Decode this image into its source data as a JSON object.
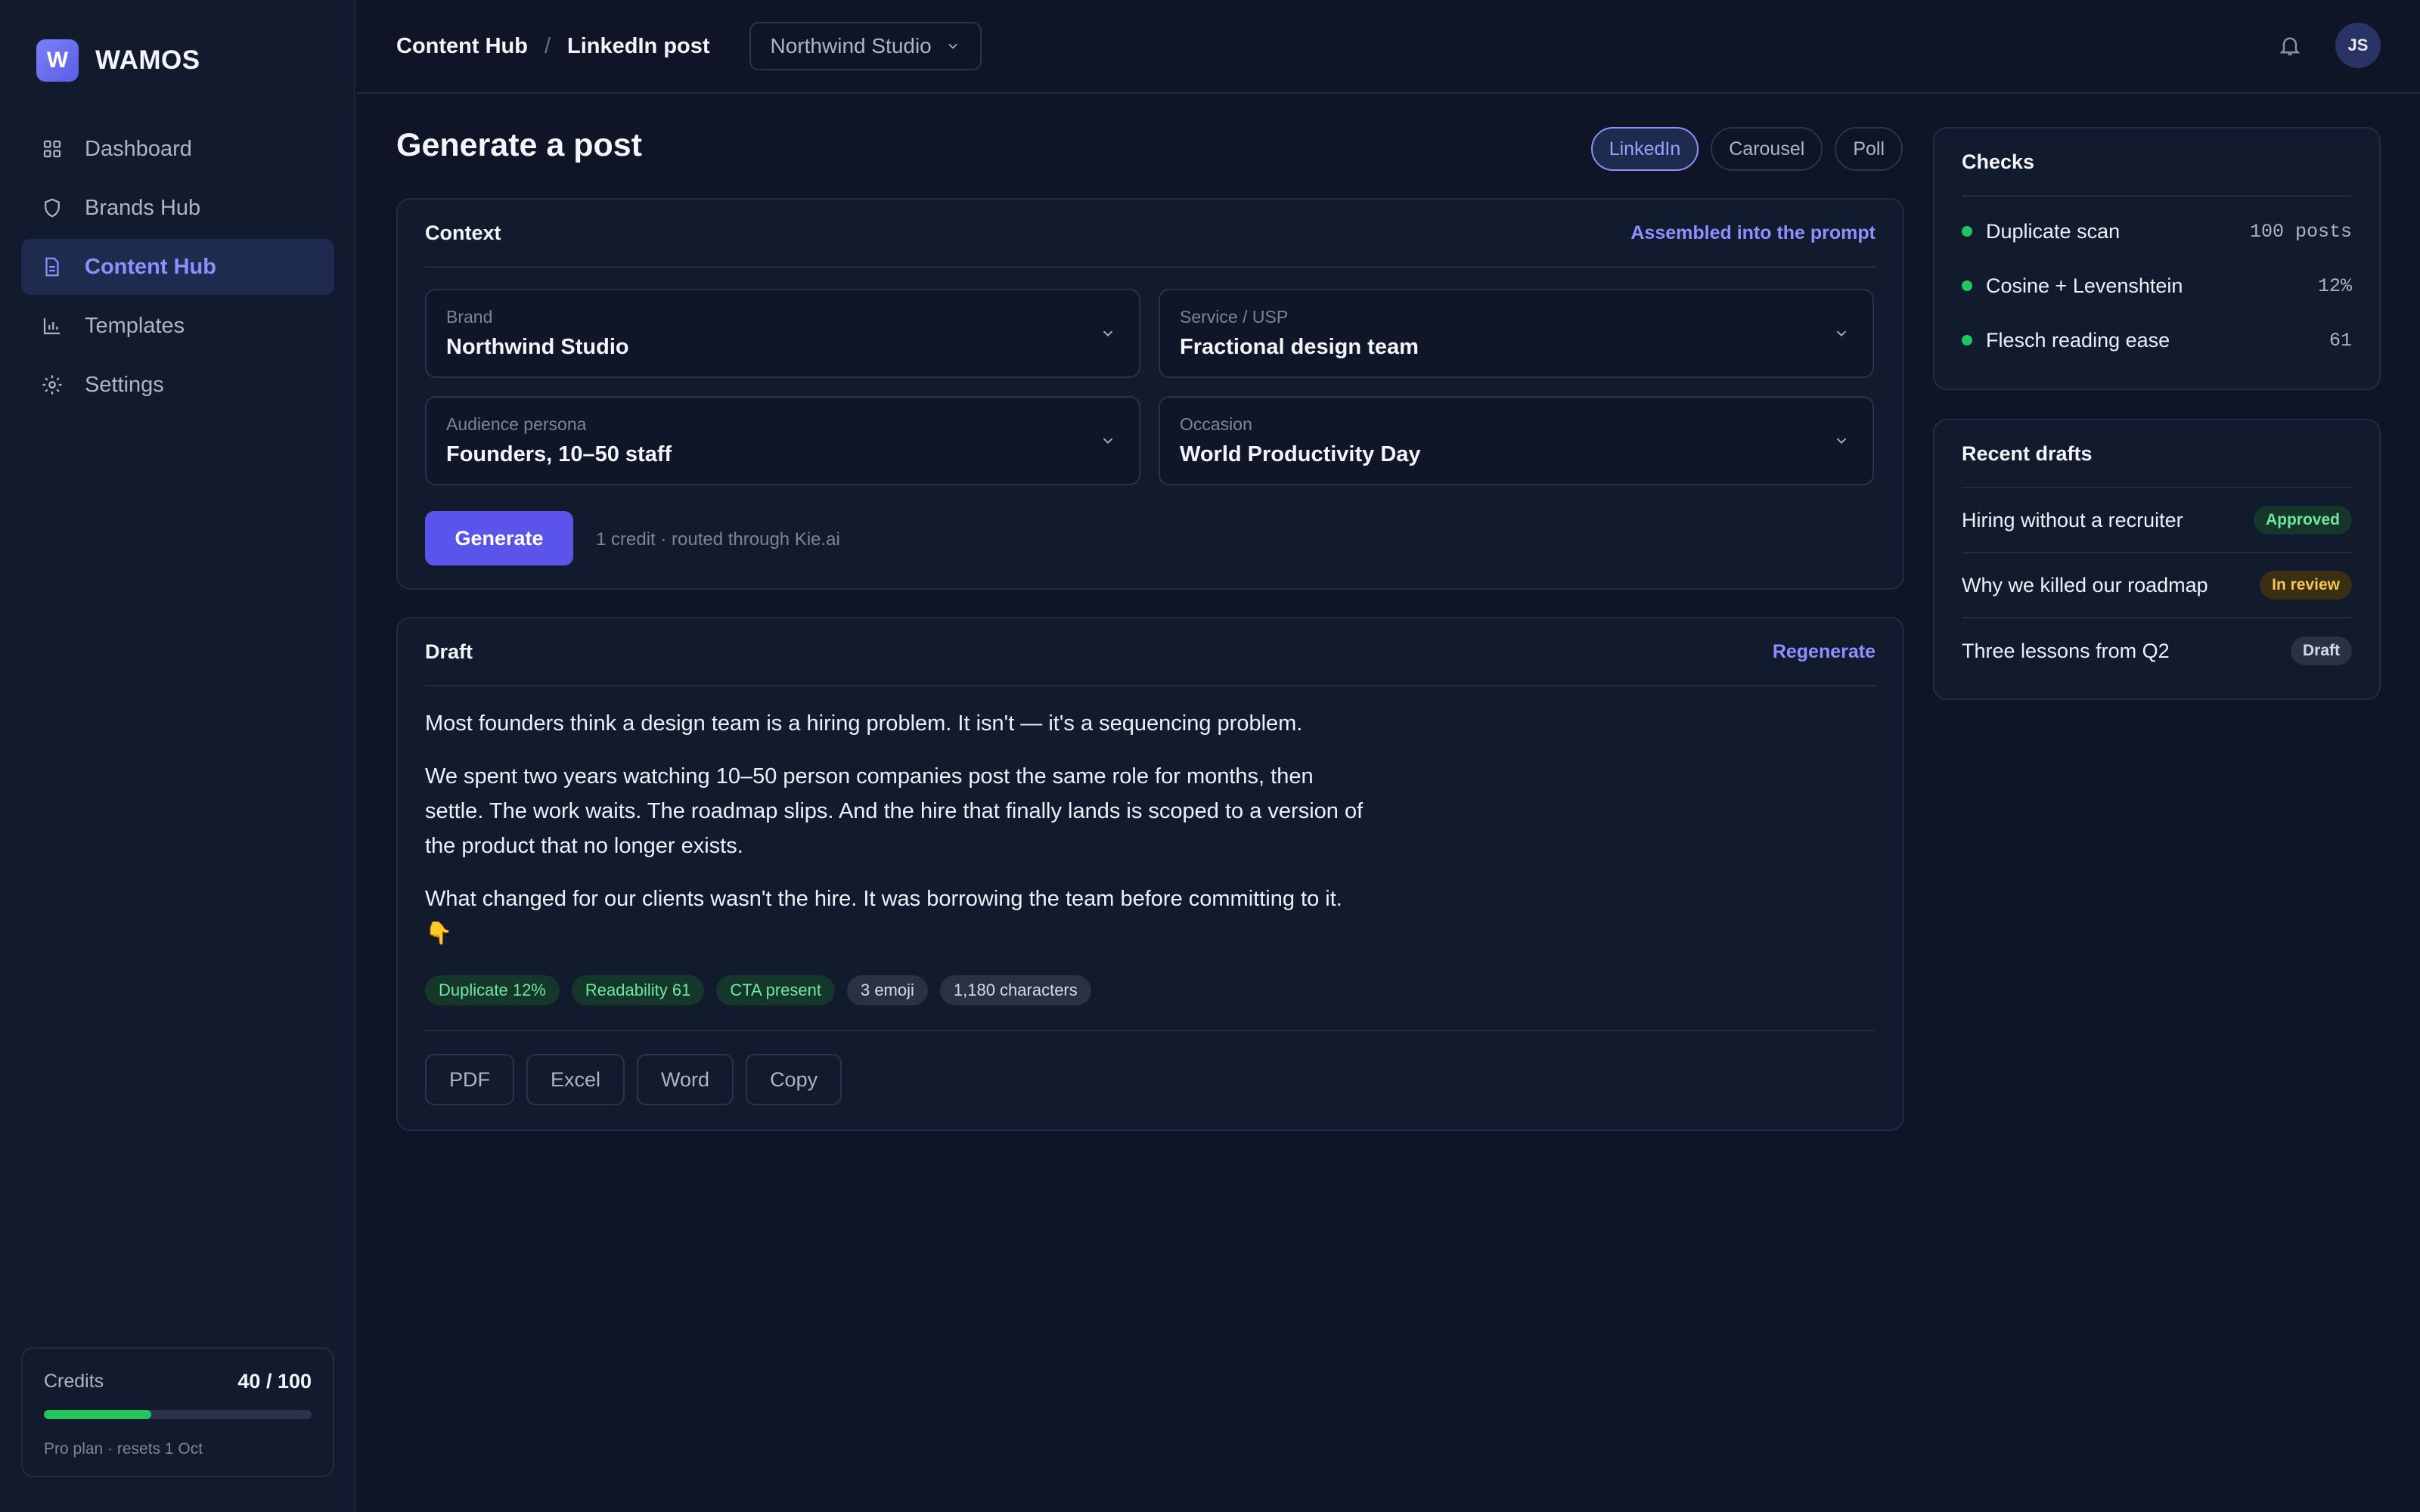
{
  "app": {
    "logo_letter": "W",
    "name": "WAMOS"
  },
  "sidebar": {
    "items": [
      {
        "label": "Dashboard",
        "icon": "grid-icon"
      },
      {
        "label": "Brands Hub",
        "icon": "shield-icon"
      },
      {
        "label": "Content Hub",
        "icon": "document-icon",
        "active": true
      },
      {
        "label": "Templates",
        "icon": "bar-chart-icon"
      },
      {
        "label": "Settings",
        "icon": "gear-icon"
      }
    ]
  },
  "credits": {
    "label": "Credits",
    "value": "40 / 100",
    "used_fraction": 0.4,
    "plan": "Pro plan · resets 1 Oct"
  },
  "topbar": {
    "breadcrumb": [
      "Content Hub",
      "LinkedIn post"
    ],
    "separator": "/",
    "org_select": "Northwind Studio",
    "avatar_initials": "JS"
  },
  "main": {
    "title": "Generate a post",
    "post_types": [
      {
        "label": "LinkedIn",
        "active": true
      },
      {
        "label": "Carousel"
      },
      {
        "label": "Poll"
      }
    ],
    "context": {
      "title": "Context",
      "link": "Assembled into the prompt",
      "fields": [
        {
          "label": "Brand",
          "value": "Northwind Studio"
        },
        {
          "label": "Service / USP",
          "value": "Fractional design team"
        },
        {
          "label": "Audience persona",
          "value": "Founders, 10–50 staff"
        },
        {
          "label": "Occasion",
          "value": "World Productivity Day"
        }
      ],
      "generate_label": "Generate",
      "generate_note": "1 credit · routed through Kie.ai"
    },
    "draft": {
      "title": "Draft",
      "link": "Regenerate",
      "paragraphs": [
        "Most founders think a design team is a hiring problem. It isn't — it's a sequencing problem.",
        "We spent two years watching 10–50 person companies post the same role for months, then settle. The work waits. The roadmap slips. And the hire that finally lands is scoped to a version of the product that no longer exists.",
        "What changed for our clients wasn't the hire. It was borrowing the team before committing to it. 👇"
      ],
      "chips": [
        {
          "label": "Duplicate 12%",
          "tone": "green"
        },
        {
          "label": "Readability 61",
          "tone": "green"
        },
        {
          "label": "CTA present",
          "tone": "green"
        },
        {
          "label": "3 emoji",
          "tone": "gray"
        },
        {
          "label": "1,180 characters",
          "tone": "gray"
        }
      ],
      "exports": [
        "PDF",
        "Excel",
        "Word",
        "Copy"
      ]
    }
  },
  "checks": {
    "title": "Checks",
    "items": [
      {
        "label": "Duplicate scan",
        "value": "100 posts"
      },
      {
        "label": "Cosine + Levenshtein",
        "value": "12%"
      },
      {
        "label": "Flesch reading ease",
        "value": "61"
      }
    ]
  },
  "recent_drafts": {
    "title": "Recent drafts",
    "items": [
      {
        "title": "Hiring without a recruiter",
        "status": "Approved"
      },
      {
        "title": "Why we killed our roadmap",
        "status": "In review"
      },
      {
        "title": "Three lessons from Q2",
        "status": "Draft"
      }
    ]
  },
  "colors": {
    "accent": "#5b54ea",
    "accent_text": "#8c91ff",
    "success": "#22c55e",
    "warning": "#f5c451",
    "background": "#0f1426"
  }
}
